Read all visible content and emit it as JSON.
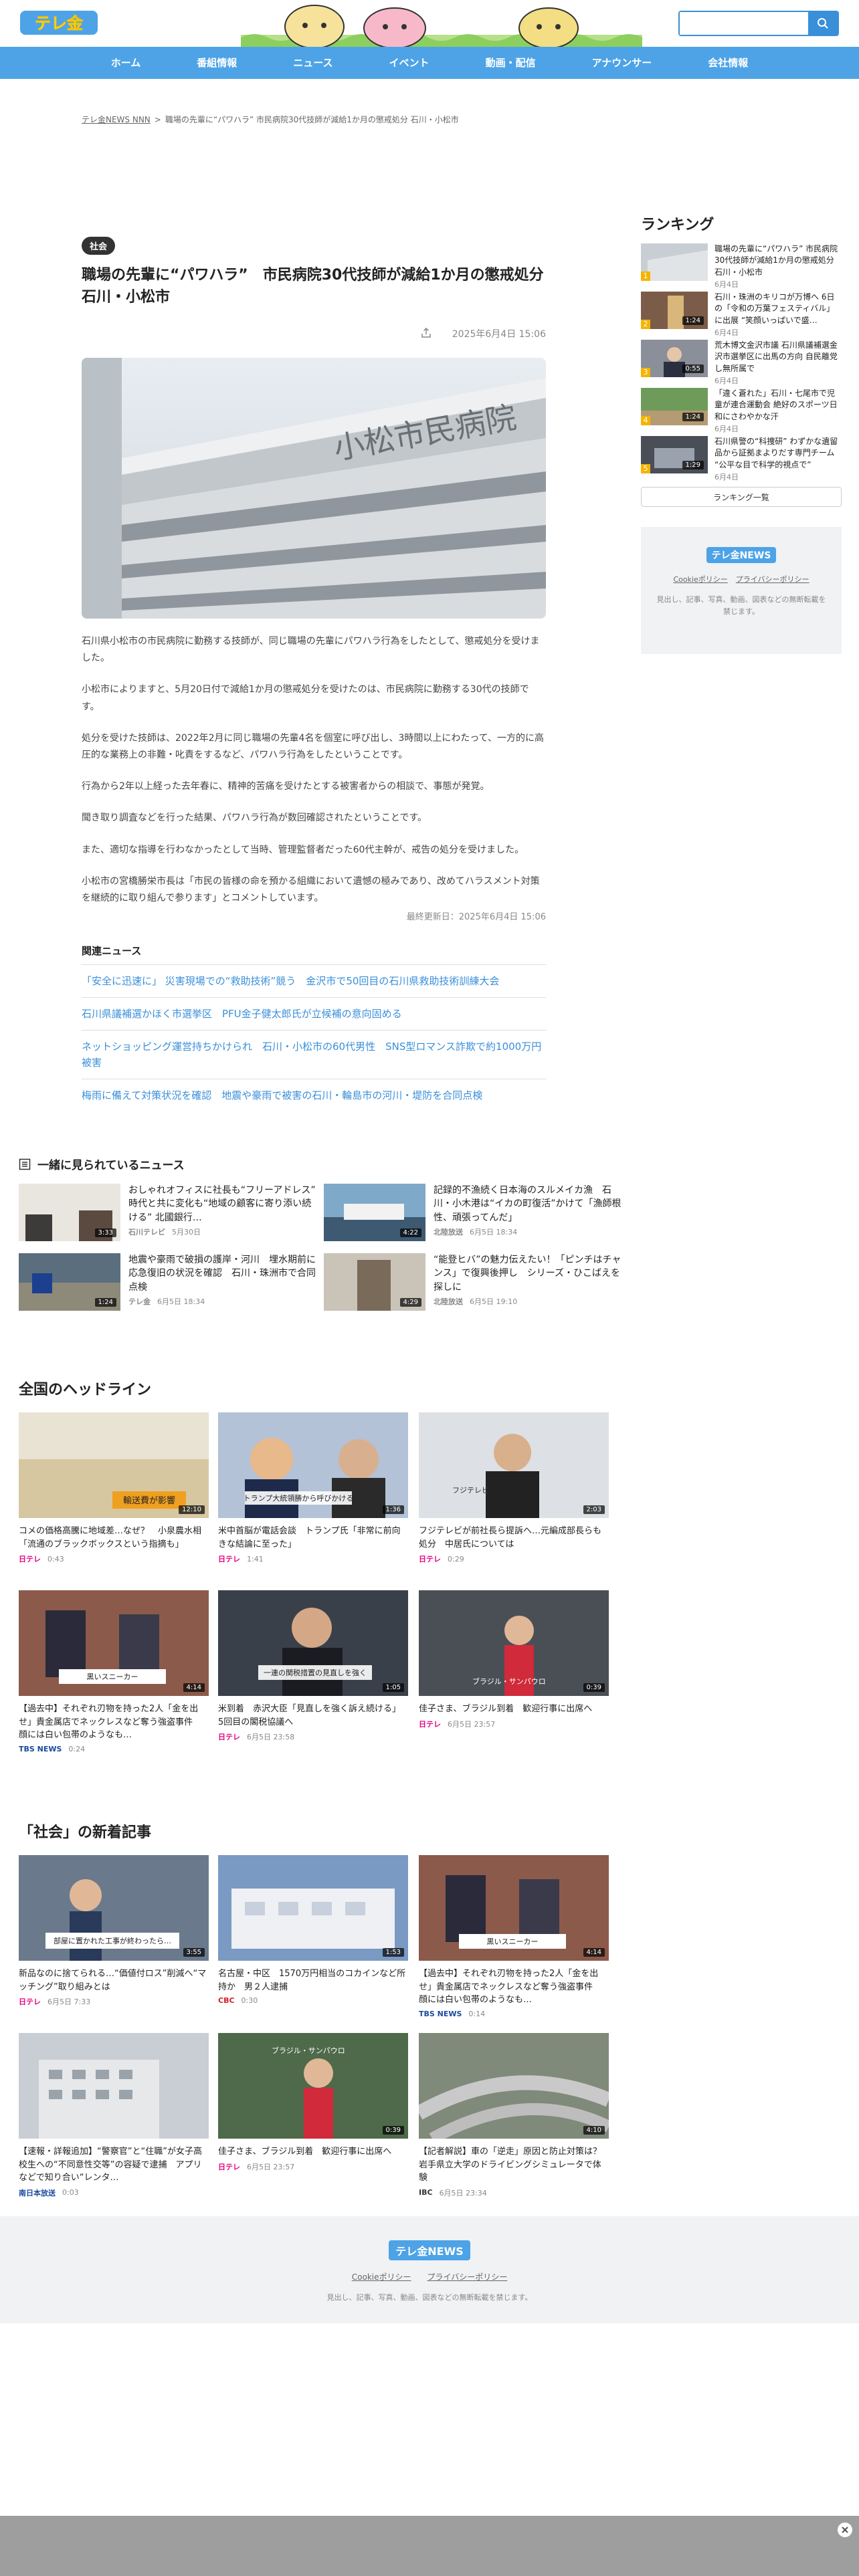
{
  "header": {
    "logo_text": "テレ金",
    "search_placeholder": ""
  },
  "nav": [
    "ホーム",
    "番組情報",
    "ニュース",
    "イベント",
    "動画・配信",
    "アナウンサー",
    "会社情報"
  ],
  "breadcrumb": {
    "home": "テレ金NEWS NNN",
    "sep": ">",
    "current": "職場の先輩に“パワハラ” 市民病院30代技師が減給1か月の懲戒処分 石川・小松市"
  },
  "article": {
    "category": "社会",
    "title": "職場の先輩に“パワハラ”　市民病院30代技師が減給1か月の懲戒処分　石川・小松市",
    "date": "2025年6月4日 15:06",
    "hero_sign": "小松市民病院",
    "paragraphs": [
      "石川県小松市の市民病院に勤務する技師が、同じ職場の先輩にパワハラ行為をしたとして、懲戒処分を受けました。",
      "小松市によりますと、5月20日付で減給1か月の懲戒処分を受けたのは、市民病院に勤務する30代の技師です。",
      "処分を受けた技師は、2022年2月に同じ職場の先輩4名を個室に呼び出し、3時間以上にわたって、一方的に高圧的な業務上の非難・叱責をするなど、パワハラ行為をしたということです。",
      "行為から2年以上経った去年春に、精神的苦痛を受けたとする被害者からの相談で、事態が発覚。",
      "聞き取り調査などを行った結果、パワハラ行為が数回確認されたということです。",
      "また、適切な指導を行わなかったとして当時、管理監督者だった60代主幹が、戒告の処分を受けました。",
      "小松市の宮橋勝栄市長は「市民の皆様の命を預かる組織において遺憾の極みであり、改めてハラスメント対策を継続的に取り組んで参ります」とコメントしています。"
    ],
    "updated": "最終更新日：2025年6月4日 15:06",
    "related_heading": "関連ニュース",
    "related": [
      "「安全に迅速に」 災害現場での“救助技術”競う　金沢市で50回目の石川県救助技術訓練大会",
      "石川県議補選かほく市選挙区　PFU金子健太郎氏が立候補の意向固める",
      "ネットショッピング運営持ちかけられ　石川・小松市の60代男性　SNS型ロマンス詐欺で約1000万円被害",
      "梅雨に備えて対策状況を確認　地震や豪雨で被害の石川・輪島市の河川・堤防を合同点検"
    ]
  },
  "sidebar": {
    "heading": "ランキング",
    "ranking": [
      {
        "num": "1",
        "title": "職場の先輩に“パワハラ” 市民病院30代技師が減給1か月の懲戒処分 石川・小松市",
        "date": "6月4日",
        "dur": ""
      },
      {
        "num": "2",
        "title": "石川・珠洲のキリコが万博へ 6日の「令和の万葉フェスティバル」に出展 “笑顔いっぱいで盛…",
        "date": "6月4日",
        "dur": "1:24"
      },
      {
        "num": "3",
        "title": "荒木博文金沢市議 石川県議補選金沢市選挙区に出馬の方向 自民離党し無所属で",
        "date": "6月4日",
        "dur": "0:55"
      },
      {
        "num": "4",
        "title": "「違く蒼れた」石川・七尾市で児童が連合運動会 絶好のスポーツ日和にさわやかな汗",
        "date": "6月4日",
        "dur": "1:24"
      },
      {
        "num": "5",
        "title": "石川県警の“科捜研” わずかな遺留品から証拠まよりだす専門チーム “公平な目で科学的視点で”",
        "date": "6月4日",
        "dur": "1:29"
      }
    ],
    "ranking_button": "ランキング一覧",
    "box_logo": "テレ金NEWS",
    "box_links": [
      "Cookieポリシー",
      "プライバシーポリシー"
    ],
    "box_note": "見出し、記事、写真、動画、図表などの無断転載を禁じます。"
  },
  "seen_together": {
    "heading": "一緒に見られているニュース",
    "items": [
      {
        "title": "おしゃれオフィスに社長も“フリーアドレス” 時代と共に変化も“地域の顧客に寄り添い続ける” 北國銀行…",
        "src": "石川テレビ",
        "date": "5月30日",
        "dur": "3:33"
      },
      {
        "title": "記録的不漁続く日本海のスルメイカ漁　石川・小木港は“イカの町復活”かけて「漁師根性、頑張ってんだ」",
        "src": "北陸放送",
        "date": "6月5日 18:34",
        "dur": "4:22"
      },
      {
        "title": "地震や豪雨で破損の護岸・河川　埋水期前に応急復旧の状況を確認　石川・珠洲市で合同点検",
        "src": "テレ金",
        "date": "6月5日 18:34",
        "dur": "1:24"
      },
      {
        "title": "“能登ヒバ”の魅力伝えたい！「ピンチはチャンス」で復興後押し　シリーズ・ひこばえを探しに",
        "src": "北陸放送",
        "date": "6月5日 19:10",
        "dur": "4:29"
      }
    ]
  },
  "headlines": {
    "heading": "全国のヘッドライン",
    "items": [
      {
        "title": "コメの価格高騰に地域差…なぜ？　小泉農水相「流通のブラックボックスという指摘も」",
        "src": "日テレ",
        "date": "0:43",
        "dur": "12:10",
        "caption": "輸送費が影響"
      },
      {
        "title": "米中首脳が電話会談　トランプ氏「非常に前向きな結論に至った」",
        "src": "日テレ",
        "date": "1:41",
        "dur": "1:36",
        "caption": "トランプ大統領勝から呼びかける"
      },
      {
        "title": "フジテレビが前社長ら提訴へ…元編成部長らも処分　中居氏については",
        "src": "日テレ",
        "date": "0:29",
        "dur": "2:03",
        "caption": "フジテレビ"
      },
      {
        "title": "【過去中】それぞれ刃物を持った2人「金を出せ」貴金属店でネックレスなど奪う強盗事件　顔には白い包帯のようなも…",
        "src": "TBS NEWS",
        "date": "0:24",
        "dur": "4:14",
        "caption": "黒いスニーカー"
      },
      {
        "title": "米到着　赤沢大臣「見直しを強く訴え続ける」 5回目の閣税協議へ",
        "src": "日テレ",
        "date": "6月5日 23:58",
        "dur": "1:05",
        "caption": "一連の関税措置の見直しを強く"
      },
      {
        "title": "佳子さま、ブラジル到着　歓迎行事に出席へ",
        "src": "日テレ",
        "date": "6月5日 23:57",
        "dur": "0:39",
        "caption": "ブラジル・サンパウロ"
      }
    ]
  },
  "shakai": {
    "heading": "「社会」の新着記事",
    "items": [
      {
        "title": "新品なのに捨てられる…“価値付ロス”削減へ“マッチング”取り組みとは",
        "src": "日テレ",
        "date": "6月5日 7:33",
        "dur": "3:55",
        "caption": "部屋に置かれた工事が終わったら…"
      },
      {
        "title": "名古屋・中区　1570万円相当のコカインなど所持か　男２人逮捕",
        "src": "CBC",
        "date": "0:30",
        "dur": "1:53",
        "caption": ""
      },
      {
        "title": "【過去中】それぞれ刃物を持った2人「金を出せ」貴金属店でネックレスなど奪う強盗事件　顔には白い包帯のようなも…",
        "src": "TBS NEWS",
        "date": "0:14",
        "dur": "4:14",
        "caption": "黒いスニーカー"
      },
      {
        "title": "【速報・詳報追加】“警察官”と“住職”が女子高校生への“不同意性交等”の容疑で逮捕　アプリなどで知り合い“レンタ…",
        "src": "南日本放送",
        "date": "0:03",
        "dur": "",
        "caption": ""
      },
      {
        "title": "佳子さま、ブラジル到着　歓迎行事に出席へ",
        "src": "日テレ",
        "date": "6月5日 23:57",
        "dur": "0:39",
        "caption": "ブラジル・サンパウロ"
      },
      {
        "title": "【記者解説】車の「逆走」原因と防止対策は？岩手県立大学のドライビングシミュレータで体験",
        "src": "IBC",
        "date": "6月5日 23:34",
        "dur": "4:10",
        "caption": ""
      }
    ]
  },
  "footer": {
    "logo": "テレ金NEWS",
    "links": [
      "Cookieポリシー",
      "プライバシーポリシー"
    ],
    "note": "見出し、記事、写真、動画、図表などの無断転載を禁じます。"
  },
  "colors": {
    "accent": "#4da3e6",
    "link": "#3a8fd9"
  }
}
